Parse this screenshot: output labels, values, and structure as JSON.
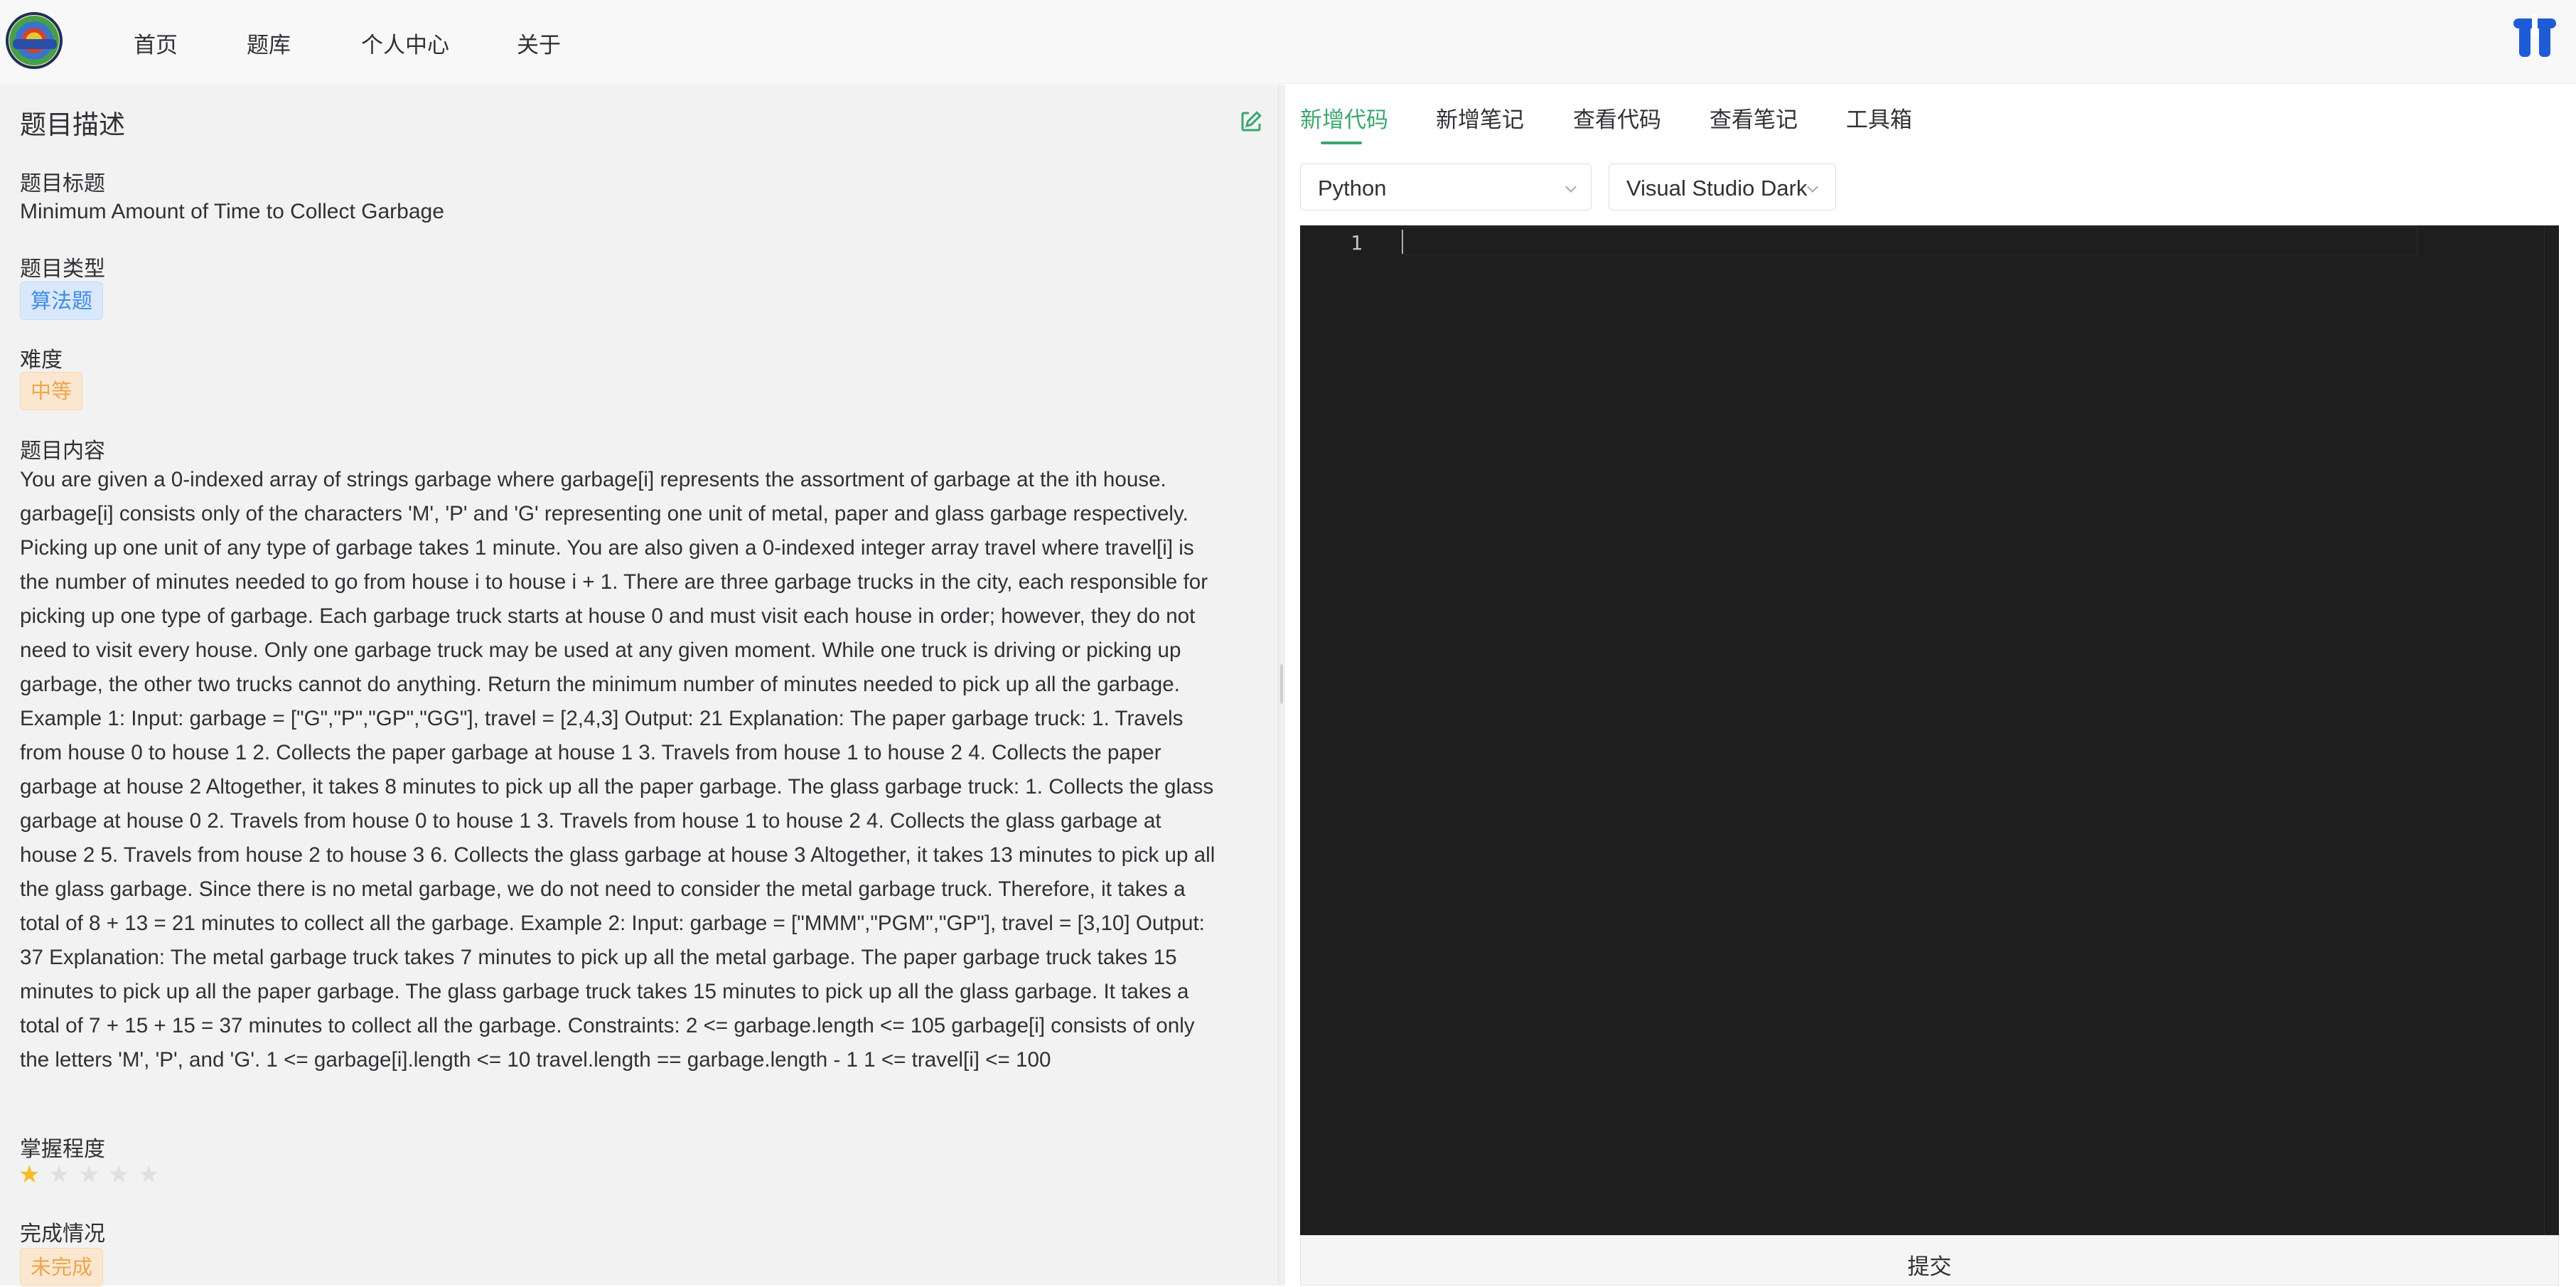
{
  "nav": {
    "items": [
      "首页",
      "题库",
      "个人中心",
      "关于"
    ]
  },
  "left": {
    "header": "题目描述",
    "title_label": "题目标题",
    "title_value": "Minimum Amount of Time to Collect Garbage",
    "type_label": "题目类型",
    "type_value": "算法题",
    "difficulty_label": "难度",
    "difficulty_value": "中等",
    "content_label": "题目内容",
    "content": "You are given a 0-indexed array of strings garbage where garbage[i] represents the assortment of garbage at the ith house. garbage[i] consists only of the characters 'M', 'P' and 'G' representing one unit of metal, paper and glass garbage respectively. Picking up one unit of any type of garbage takes 1 minute. You are also given a 0-indexed integer array travel where travel[i] is the number of minutes needed to go from house i to house i + 1. There are three garbage trucks in the city, each responsible for picking up one type of garbage. Each garbage truck starts at house 0 and must visit each house in order; however, they do not need to visit every house. Only one garbage truck may be used at any given moment. While one truck is driving or picking up garbage, the other two trucks cannot do anything. Return the minimum number of minutes needed to pick up all the garbage.   Example 1: Input: garbage = [\"G\",\"P\",\"GP\",\"GG\"], travel = [2,4,3] Output: 21 Explanation: The paper garbage truck: 1. Travels from house 0 to house 1 2. Collects the paper garbage at house 1 3. Travels from house 1 to house 2 4. Collects the paper garbage at house 2 Altogether, it takes 8 minutes to pick up all the paper garbage. The glass garbage truck: 1. Collects the glass garbage at house 0 2. Travels from house 0 to house 1 3. Travels from house 1 to house 2 4. Collects the glass garbage at house 2 5. Travels from house 2 to house 3 6. Collects the glass garbage at house 3 Altogether, it takes 13 minutes to pick up all the glass garbage. Since there is no metal garbage, we do not need to consider the metal garbage truck. Therefore, it takes a total of 8 + 13 = 21 minutes to collect all the garbage. Example 2: Input: garbage = [\"MMM\",\"PGM\",\"GP\"], travel = [3,10] Output: 37 Explanation: The metal garbage truck takes 7 minutes to pick up all the metal garbage. The paper garbage truck takes 15 minutes to pick up all the paper garbage. The glass garbage truck takes 15 minutes to pick up all the glass garbage. It takes a total of 7 + 15 + 15 = 37 minutes to collect all the garbage. Constraints: 2 <= garbage.length <= 105 garbage[i] consists of only the letters 'M', 'P', and 'G'. 1 <= garbage[i].length <= 10 travel.length == garbage.length - 1 1 <= travel[i] <= 100",
    "mastery_label": "掌握程度",
    "mastery_rating": 1,
    "mastery_max": 5,
    "status_label": "完成情况",
    "status_value": "未完成"
  },
  "right": {
    "tabs": [
      "新增代码",
      "新增笔记",
      "查看代码",
      "查看笔记",
      "工具箱"
    ],
    "active_tab": 0,
    "language": "Python",
    "theme": "Visual Studio Dark",
    "line_number": "1",
    "submit_label": "提交"
  },
  "colors": {
    "accent": "#3aa76d",
    "editor_bg": "#1e1e1e",
    "panel_bg": "#f2f2f2",
    "star_on": "#f7ba2a"
  }
}
